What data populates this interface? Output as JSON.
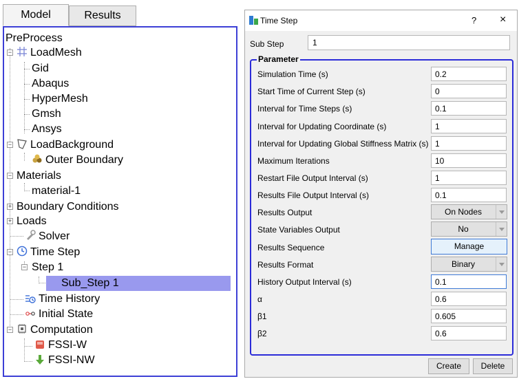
{
  "tabs": {
    "model": "Model",
    "results": "Results"
  },
  "tree": {
    "root": "PreProcess",
    "load_mesh": "LoadMesh",
    "gid": "Gid",
    "abaqus": "Abaqus",
    "hypermesh": "HyperMesh",
    "gmsh": "Gmsh",
    "ansys": "Ansys",
    "load_background": "LoadBackground",
    "outer_boundary": "Outer Boundary",
    "materials": "Materials",
    "material_1": "material-1",
    "boundary_conditions": "Boundary Conditions",
    "loads": "Loads",
    "solver": "Solver",
    "time_step": "Time Step",
    "step_1": "Step 1",
    "sub_step_1": "Sub_Step 1",
    "time_history": "Time History",
    "initial_state": "Initial State",
    "computation": "Computation",
    "fssi_w": "FSSI-W",
    "fssi_nw": "FSSI-NW"
  },
  "dialog": {
    "title": "Time Step",
    "help": "?",
    "close": "×",
    "sub_step_label": "Sub Step",
    "sub_step_value": "1",
    "group_title": "Parameter",
    "params": [
      {
        "label": "Simulation Time (s)",
        "value": "0.2"
      },
      {
        "label": "Start Time of Current Step (s)",
        "value": "0"
      },
      {
        "label": "Interval for Time Steps (s)",
        "value": "0.1"
      },
      {
        "label": "Interval for Updating Coordinate (s)",
        "value": "1"
      },
      {
        "label": "Interval for Updating Global Stiffness Matrix (s)",
        "value": "1"
      },
      {
        "label": "Maximum Iterations",
        "value": "10"
      },
      {
        "label": "Restart File Output Interval (s)",
        "value": "1"
      },
      {
        "label": "Results File Output Interval (s)",
        "value": "0.1"
      }
    ],
    "results_output": {
      "label": "Results Output",
      "value": "On Nodes"
    },
    "state_variables_output": {
      "label": "State Variables Output",
      "value": "No"
    },
    "results_sequence": {
      "label": "Results Sequence",
      "button": "Manage"
    },
    "results_format": {
      "label": "Results Format",
      "value": "Binary"
    },
    "params2": [
      {
        "label": "History Output Interval (s)",
        "value": "0.1"
      },
      {
        "label": "α",
        "value": "0.6"
      },
      {
        "label": "β1",
        "value": "0.605"
      },
      {
        "label": "β2",
        "value": "0.6"
      }
    ],
    "create": "Create",
    "delete": "Delete"
  },
  "colors": {
    "frame_blue": "#3c3fd6",
    "selection": "#9999ee",
    "group_border": "#2b2bd8"
  },
  "icons": [
    "grid-mesh-icon",
    "background-shape-icon",
    "outer-boundary-icon",
    "solver-icon",
    "clock-icon",
    "time-history-icon",
    "initial-state-icon",
    "computation-icon",
    "fssi-w-icon",
    "fssi-nw-icon",
    "app-icon"
  ]
}
